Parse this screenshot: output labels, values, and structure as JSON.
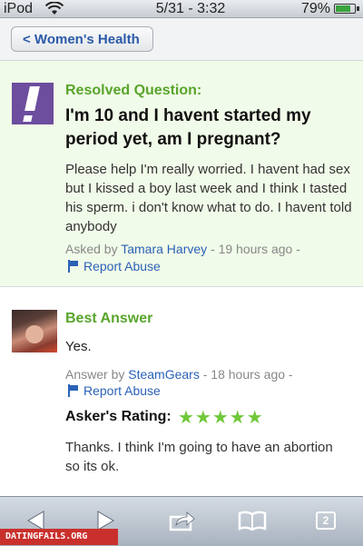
{
  "status_bar": {
    "carrier": "iPod",
    "time": "5/31 - 3:32",
    "battery": "79%",
    "battery_level": 0.79
  },
  "nav": {
    "back_label": "< Women's Health"
  },
  "question": {
    "status": "Resolved Question:",
    "title": "I'm 10 and I havent started my period yet, am I pregnant?",
    "body": "Please help I'm really worried. I havent had sex but I kissed a boy last week and I think I tasted his sperm. i don't know what to do. I havent told anybody",
    "asked_prefix": "Asked by",
    "asker": "Tamara Harvey",
    "asked_time": "- 19 hours ago -",
    "report_label": "Report Abuse"
  },
  "answer": {
    "heading": "Best Answer",
    "body": "Yes.",
    "answer_prefix": "Answer by",
    "answerer": "SteamGears",
    "answer_time": "- 18 hours ago -",
    "report_label": "Report Abuse",
    "rating_label": "Asker's Rating:",
    "stars": "★★★★★",
    "rating": 5,
    "comment": "Thanks. I think I'm going to have an abortion so its ok."
  },
  "toolbar": {
    "pages_count": "2"
  },
  "watermark": "DATINGFAILS.ORG",
  "colors": {
    "accent_green": "#59a52c",
    "link_blue": "#2b62b8",
    "question_bg": "#f1fbe9",
    "icon_purple": "#6c4d9e"
  }
}
